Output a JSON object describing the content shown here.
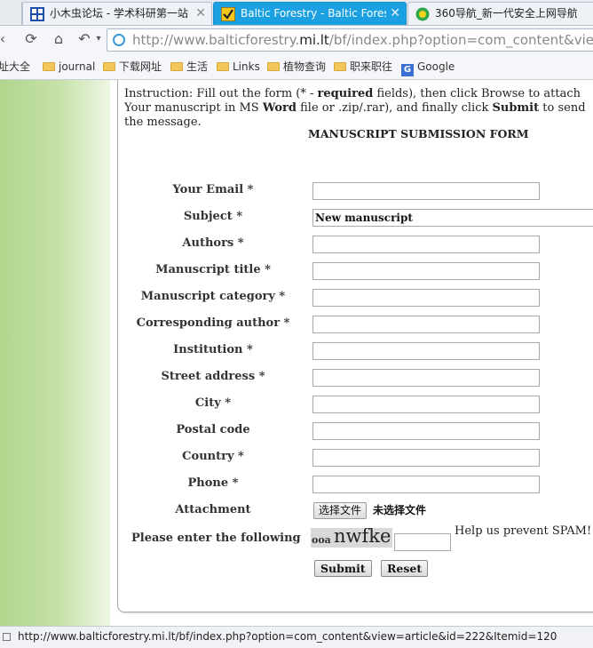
{
  "browser": {
    "tabs": [
      {
        "title": "小木虫论坛 - 学术科研第一站",
        "active": false,
        "icon": "grid-favicon-icon"
      },
      {
        "title": "Baltic Forestry - Baltic Forestry",
        "active": true,
        "icon": "check-favicon-icon"
      },
      {
        "title": "360导航_新一代安全上网导航",
        "active": false,
        "icon": "360-favicon-icon"
      }
    ],
    "address": {
      "prefix": "http://www.balticforestry.",
      "host": "mi.lt",
      "suffix": "/bf/index.php?option=com_content&view=article&id=222&Itemid=120"
    },
    "bookmarks": [
      "址大全",
      "journal",
      "下载网址",
      "生活",
      "Links",
      "植物查询",
      "职来职往",
      "Google"
    ],
    "status_text": "http://www.balticforestry.mi.lt/bf/index.php?option=com_content&view=article&id=222&Itemid=120",
    "accent_color": "#1ba1e2"
  },
  "page": {
    "instructions": {
      "p1": "Instruction: Fill out the form (* - ",
      "required": "required",
      "p2": " fields), then click Browse to attach Your manuscript in MS ",
      "word": "Word",
      "p3": " file or .zip/.rar), and finally click ",
      "submit": "Submit",
      "p4": " to send the message."
    },
    "form_title": "MANUSCRIPT SUBMISSION FORM",
    "fields": [
      {
        "label": "Your Email *",
        "value": ""
      },
      {
        "label": "Subject *",
        "value": "New manuscript"
      },
      {
        "label": "Authors *",
        "value": ""
      },
      {
        "label": "Manuscript title *",
        "value": ""
      },
      {
        "label": "Manuscript category *",
        "value": ""
      },
      {
        "label": "Corresponding author *",
        "value": ""
      },
      {
        "label": "Institution *",
        "value": ""
      },
      {
        "label": "Street address *",
        "value": ""
      },
      {
        "label": "City *",
        "value": ""
      },
      {
        "label": "Postal code",
        "value": ""
      },
      {
        "label": "Country *",
        "value": ""
      },
      {
        "label": "Phone *",
        "value": ""
      }
    ],
    "attachment": {
      "label": "Attachment",
      "button": "选择文件",
      "status": "未选择文件"
    },
    "captcha": {
      "label": "Please enter the following",
      "small_text": "ooa",
      "big_text": "nwfke",
      "value": "",
      "note": "Help us prevent SPAM!"
    },
    "buttons": {
      "submit": "Submit",
      "reset": "Reset"
    }
  }
}
